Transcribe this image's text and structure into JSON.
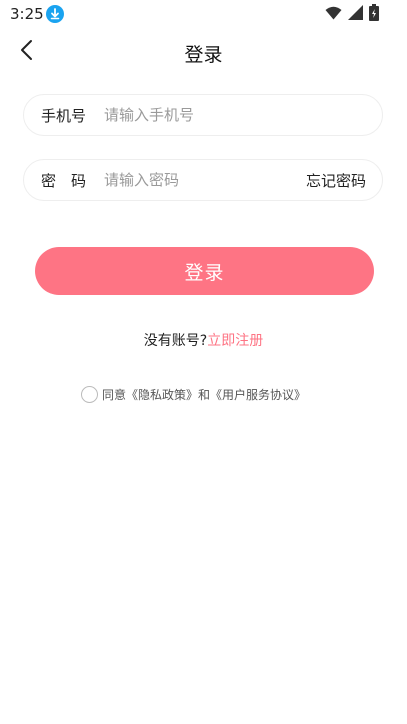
{
  "status_bar": {
    "time": "3:25"
  },
  "header": {
    "title": "登录"
  },
  "form": {
    "phone_label": "手机号",
    "phone_placeholder": "请输入手机号",
    "password_label": "密　码",
    "password_placeholder": "请输入密码",
    "forgot_password": "忘记密码",
    "login_button": "登录"
  },
  "register": {
    "prompt": "没有账号?",
    "link": "立即注册"
  },
  "agreement": {
    "prefix": "同意",
    "privacy_policy": "《隐私政策》",
    "conjunction": "和",
    "user_agreement": "《用户服务协议》"
  },
  "colors": {
    "accent": "#fe7484",
    "download_badge": "#1aa3f0"
  }
}
